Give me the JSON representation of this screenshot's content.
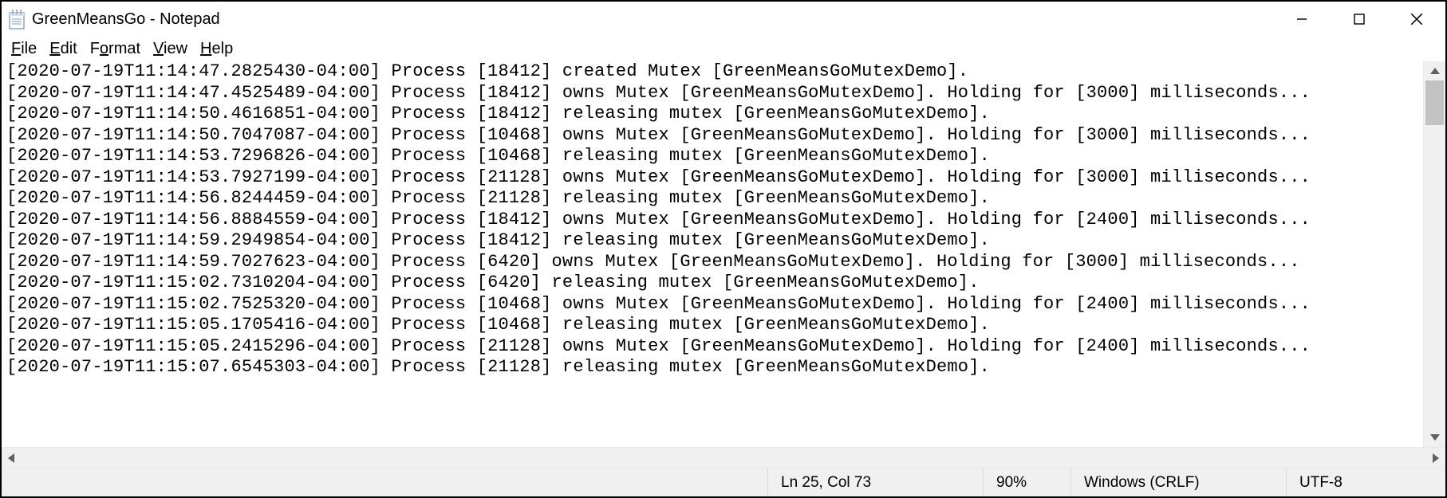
{
  "window": {
    "title": "GreenMeansGo - Notepad"
  },
  "menu": {
    "file": "File",
    "edit": "Edit",
    "format": "Format",
    "view": "View",
    "help": "Help"
  },
  "log_lines": [
    "[2020-07-19T11:14:47.2825430-04:00] Process [18412] created Mutex [GreenMeansGoMutexDemo].",
    "[2020-07-19T11:14:47.4525489-04:00] Process [18412] owns Mutex [GreenMeansGoMutexDemo]. Holding for [3000] milliseconds...",
    "[2020-07-19T11:14:50.4616851-04:00] Process [18412] releasing mutex [GreenMeansGoMutexDemo].",
    "[2020-07-19T11:14:50.7047087-04:00] Process [10468] owns Mutex [GreenMeansGoMutexDemo]. Holding for [3000] milliseconds...",
    "[2020-07-19T11:14:53.7296826-04:00] Process [10468] releasing mutex [GreenMeansGoMutexDemo].",
    "[2020-07-19T11:14:53.7927199-04:00] Process [21128] owns Mutex [GreenMeansGoMutexDemo]. Holding for [3000] milliseconds...",
    "[2020-07-19T11:14:56.8244459-04:00] Process [21128] releasing mutex [GreenMeansGoMutexDemo].",
    "[2020-07-19T11:14:56.8884559-04:00] Process [18412] owns Mutex [GreenMeansGoMutexDemo]. Holding for [2400] milliseconds...",
    "[2020-07-19T11:14:59.2949854-04:00] Process [18412] releasing mutex [GreenMeansGoMutexDemo].",
    "[2020-07-19T11:14:59.7027623-04:00] Process [6420] owns Mutex [GreenMeansGoMutexDemo]. Holding for [3000] milliseconds...",
    "[2020-07-19T11:15:02.7310204-04:00] Process [6420] releasing mutex [GreenMeansGoMutexDemo].",
    "[2020-07-19T11:15:02.7525320-04:00] Process [10468] owns Mutex [GreenMeansGoMutexDemo]. Holding for [2400] milliseconds...",
    "[2020-07-19T11:15:05.1705416-04:00] Process [10468] releasing mutex [GreenMeansGoMutexDemo].",
    "[2020-07-19T11:15:05.2415296-04:00] Process [21128] owns Mutex [GreenMeansGoMutexDemo]. Holding for [2400] milliseconds...",
    "[2020-07-19T11:15:07.6545303-04:00] Process [21128] releasing mutex [GreenMeansGoMutexDemo]."
  ],
  "status": {
    "position": "Ln 25, Col 73",
    "zoom": "90%",
    "eol": "Windows (CRLF)",
    "encoding": "UTF-8"
  }
}
